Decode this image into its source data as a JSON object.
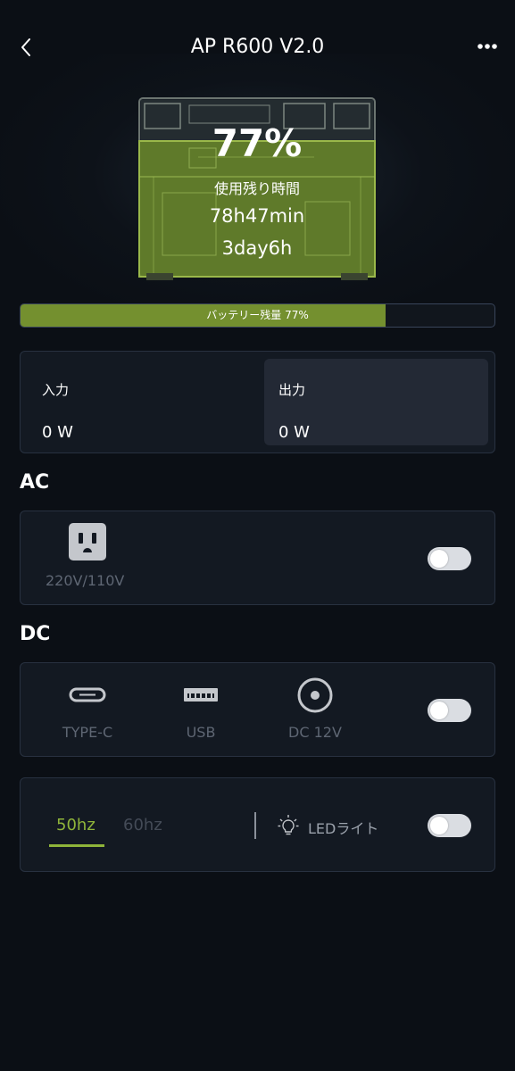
{
  "header": {
    "title": "AP R600 V2.0",
    "back_icon": "chevron-left-icon",
    "more_icon": "more-horizontal-icon"
  },
  "battery": {
    "percent_text": "77%",
    "percent": 77,
    "remaining_label": "使用残り時間",
    "remaining_hm": "78h47min",
    "remaining_dh": "3day6h",
    "bar_label": "バッテリー残量 77%",
    "fill_color": "#74902f"
  },
  "io": {
    "input_label": "入力",
    "input_value": "0 W",
    "output_label": "出力",
    "output_value": "0 W"
  },
  "ac": {
    "section_title": "AC",
    "icon": "power-outlet-icon",
    "label": "220V/110V",
    "enabled": false
  },
  "dc": {
    "section_title": "DC",
    "ports": [
      {
        "label": "TYPE-C",
        "icon": "usb-c-icon"
      },
      {
        "label": "USB",
        "icon": "usb-a-icon"
      },
      {
        "label": "DC 12V",
        "icon": "dc-port-icon"
      }
    ],
    "enabled": false
  },
  "frequency": {
    "options": [
      "50hz",
      "60hz"
    ],
    "selected": "50hz",
    "accent_color": "#8fb43a"
  },
  "led": {
    "label": "LEDライト",
    "icon": "lightbulb-icon",
    "enabled": false
  }
}
